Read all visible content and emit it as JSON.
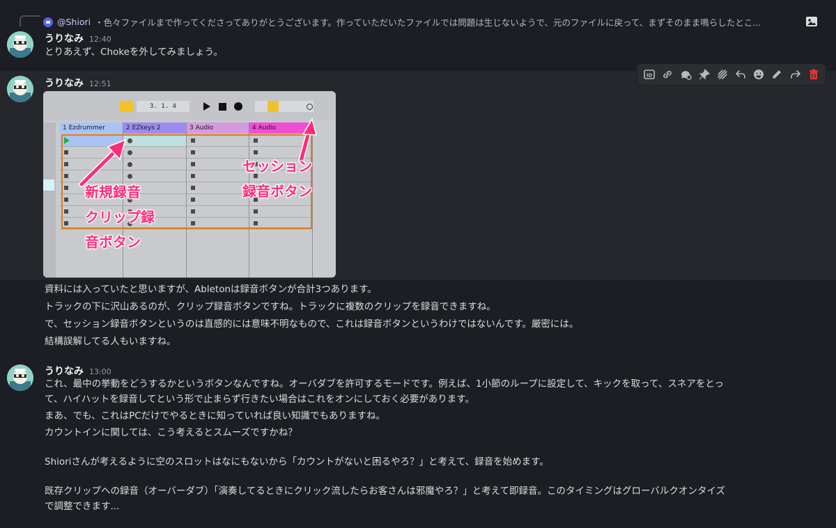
{
  "reply": {
    "mention": "@Shiori",
    "preview": "・色々ファイルまで作ってくださってありがとうございます。作っていただいたファイルでは問題は生じないようで、元のファイルに戻って、まずそのまま鳴らしたとこ..."
  },
  "messages": [
    {
      "author": "うりなみ",
      "time": "12:40",
      "lines": [
        "とりあえず、Chokeを外してみましょう。"
      ]
    },
    {
      "author": "うりなみ",
      "time": "12:51",
      "lines": [
        "資料には入っていたと思いますが、Abletonは録音ボタンが合計3つあります。",
        "トラックの下に沢山あるのが、クリップ録音ボタンですね。トラックに複数のクリップを録音できますね。",
        "で、セッション録音ボタンというのは直感的には意味不明なもので、これは録音ボタンというわけではないんです。厳密には。",
        "結構誤解してる人もいますね。"
      ]
    },
    {
      "author": "うりなみ",
      "time": "13:00",
      "lines": [
        "これ、最中の挙動をどうするかというボタンなんですね。オーバダブを許可するモードです。例えば、1小節のループに設定して、キックを取って、スネアをとっ",
        "て、ハイハットを録音してという形で止まらず行きたい場合はこれをオンにしておく必要があります。",
        "まあ、でも、これはPCだけでやるときに知っていれば良い知識でもありますね。",
        "カウントインに関しては、こう考えるとスムーズですかね？",
        "",
        "Shioriさんが考えるように空のスロットはなにもないから「カウントがないと困るやろ？」と考えて、録音を始めます。",
        "",
        "既存クリップへの録音（オーバーダブ）「演奏してるときにクリック流したらお客さんは邪魔やろ？」と考えて即録音。このタイミングはグローバルクオンタイズ",
        "で調整できます..."
      ]
    }
  ],
  "screenshot": {
    "position": "3.   1.   4",
    "tracks": [
      "1 Ezdrummer",
      "2 EZkeys 2",
      "3 Audio",
      "4 Audio"
    ],
    "track_colors": [
      "#a9c3f5",
      "#9c8cf0",
      "#d59be0",
      "#ee4fd4"
    ],
    "annotation_left": [
      "新規録音",
      "クリップ録",
      "音ボタン"
    ],
    "annotation_right": [
      "セッション",
      "録音ボタン"
    ],
    "accent": "#ff2d78"
  },
  "colors": {
    "background": "#1d1e23",
    "hover": "#26272d",
    "delete": "#da373c"
  }
}
